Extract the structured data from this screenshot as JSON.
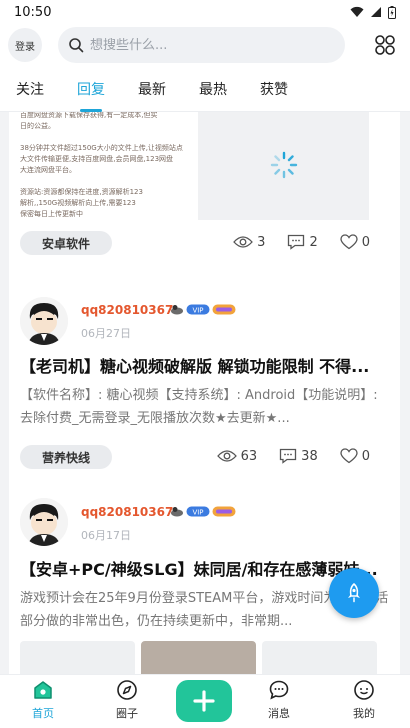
{
  "status_bar": {
    "time": "10:50"
  },
  "header": {
    "login_label": "登录",
    "search_placeholder": "想搜些什么..."
  },
  "tabs": [
    {
      "label": "关注",
      "active": false
    },
    {
      "label": "回复",
      "active": true
    },
    {
      "label": "最新",
      "active": false
    },
    {
      "label": "最热",
      "active": false
    },
    {
      "label": "获赞",
      "active": false
    }
  ],
  "posts": [
    {
      "doc_lines": [
        "百度网盘资源下载保存获得,有一定成本,但实",
        "日的公益。",
        "",
        "38分钟并文件超过150G大小的文件上传,让视频站点",
        "大文件传输更便,支持百度网盘,会员网盘,123网盘",
        "大连流网盘平台。",
        "",
        "资源站:资源都保持在进度,资源解析123",
        "解析,,150G视频解析向上传,需要123",
        "保密每日上传更新中"
      ],
      "tag": "安卓软件",
      "views": "3",
      "comments": "2",
      "likes": "0"
    },
    {
      "username": "qq820810367",
      "date": "06月27日",
      "title": "【老司机】糖心视频破解版 解锁功能限制 不得...",
      "desc": "【软件名称】: 糖心视频【支持系统】: Android【功能说明】: 去除付费_无需登录_无限播放次数★去更新★...",
      "tag": "营养快线",
      "views": "63",
      "comments": "38",
      "likes": "0"
    },
    {
      "username": "qq820810367",
      "date": "06月17日",
      "title": "【安卓+PC/神级SLG】妹同居/和存在感薄弱妹...",
      "desc": "游戏预计会在25年9月份登录STEAM平台，游戏时间为日常生活部分做的非常出色，仍在持续更新中，非常期..."
    }
  ],
  "bottom_nav": [
    {
      "label": "首页",
      "icon": "home-icon",
      "active": true
    },
    {
      "label": "圈子",
      "icon": "compass-icon",
      "active": false
    },
    {
      "label": "消息",
      "icon": "message-icon",
      "active": false
    },
    {
      "label": "我的",
      "icon": "profile-icon",
      "active": false
    }
  ],
  "colors": {
    "accent": "#1ea5d8",
    "add_button": "#22c59a",
    "username": "#e4572e",
    "fab": "#1e9bf0"
  }
}
